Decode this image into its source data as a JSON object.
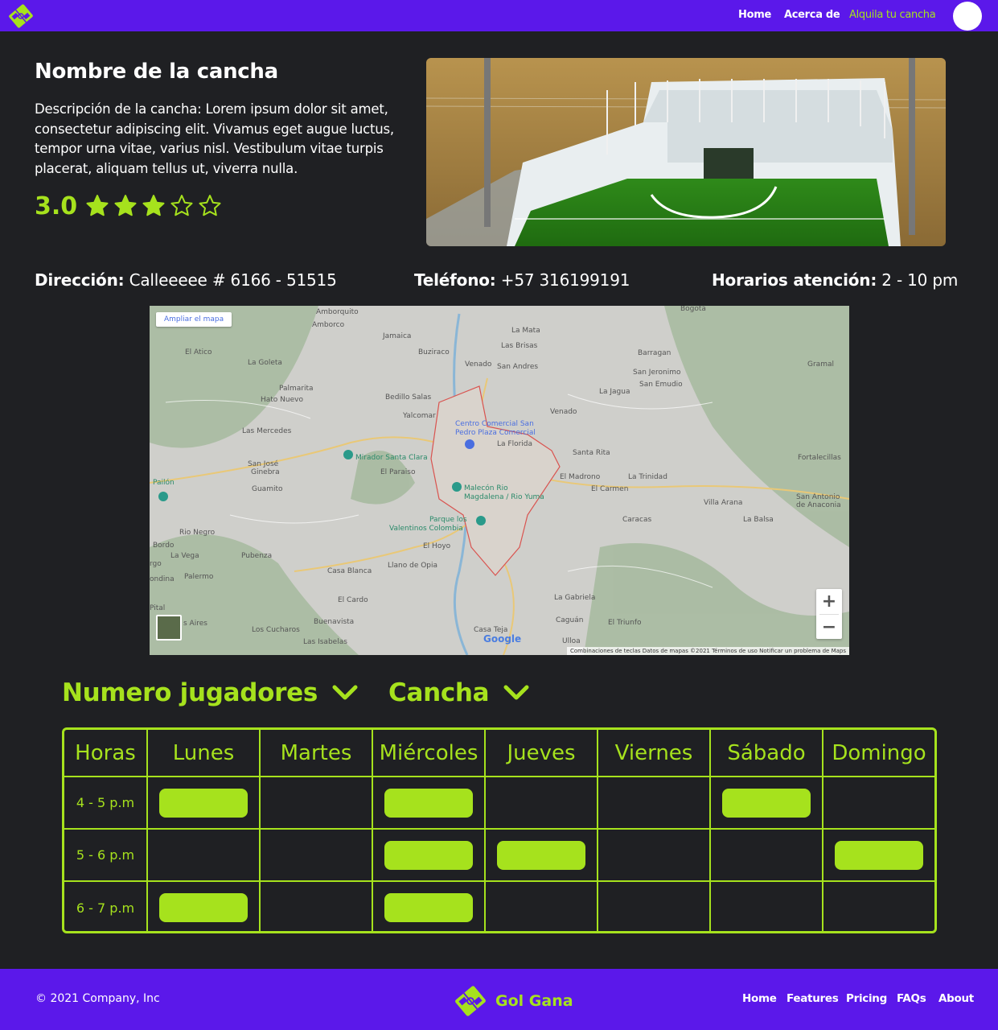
{
  "nav": {
    "home": "Home",
    "about": "Acerca de",
    "rent": "Alquila tu cancha",
    "accent_color": "#a6e21d",
    "background_color": "#5b18ea"
  },
  "court": {
    "name": "Nombre de la cancha",
    "description": "Descripción de la cancha: Lorem ipsum dolor sit amet, consectetur adipiscing elit. Vivamus eget augue luctus, tempor urna vitae, varius nisl. Vestibulum vitae turpis placerat, aliquam tellus ut, viverra nulla.",
    "rating": "3.0",
    "stars_filled": 3,
    "stars_total": 5
  },
  "info": {
    "address_label": "Dirección:",
    "address_value": "Calleeeee # 6166 - 51515",
    "phone_label": "Teléfono:",
    "phone_value": "+57 316199191",
    "hours_label": "Horarios atención:",
    "hours_value": "2 - 10 pm"
  },
  "map": {
    "expand_button": "Ampliar el mapa",
    "zoom_in": "+",
    "zoom_out": "−",
    "google": "Google",
    "footer_text": "Combinaciones de teclas   Datos de mapas ©2021   Términos de uso   Notificar un problema de Maps",
    "places": [
      "Amborquito",
      "Amborco",
      "Bogotá",
      "Jamaica",
      "La Mata",
      "Las Brisas",
      "El Atico",
      "Buziraco",
      "Venado",
      "San Andres",
      "Barragan",
      "Gramal",
      "La Goleta",
      "San Jeronimo",
      "San Emudio",
      "Palmarita",
      "Hato Nuevo",
      "La Jagua",
      "Bedillo Salas",
      "Yalcomar",
      "Venado",
      "Centro Comercial San Pedro Plaza Comercial",
      "La Florida",
      "Las Mercedes",
      "Mirador Santa Clara",
      "Santa Rita",
      "Fortalecillas",
      "San José Ginebra",
      "El Paraiso",
      "Pailón",
      "Guamito",
      "Malecón Rio Magdalena / Rio Yuma",
      "El Madrono",
      "La Trinidad",
      "El Carmen",
      "San Antonio de Anaconia",
      "Villa Arana",
      "Rio Negro",
      "Parque los Valentinos Colombia",
      "Caracas",
      "La Balsa",
      "Bordo",
      "La Vega",
      "Pubenza",
      "El Hoyo",
      "Palermo",
      "Casa Blanca",
      "Llano de Opia",
      "El Cardo",
      "La Gabriela",
      "Pital",
      "Buenavista",
      "Caguán",
      "El Triunfo",
      "Los Cucharos",
      "Las Isabelas",
      "Casa Teja",
      "Ulloa",
      "Aires",
      "ondina",
      "rgo"
    ]
  },
  "filters": {
    "players": "Numero jugadores",
    "court": "Cancha"
  },
  "schedule": {
    "headers": [
      "Horas",
      "Lunes",
      "Martes",
      "Miércoles",
      "Jueves",
      "Viernes",
      "Sábado",
      "Domingo"
    ],
    "rows": [
      {
        "hour": "4 - 5 p.m",
        "slots": [
          true,
          false,
          true,
          false,
          false,
          true,
          false
        ]
      },
      {
        "hour": "5 - 6 p.m",
        "slots": [
          false,
          false,
          true,
          true,
          false,
          false,
          true
        ]
      },
      {
        "hour": "6 - 7 p.m",
        "slots": [
          true,
          false,
          true,
          false,
          false,
          false,
          false
        ]
      }
    ]
  },
  "footer": {
    "copyright": "© 2021 Company, Inc",
    "brand": "Gol Gana",
    "links": [
      "Home",
      "Features",
      "Pricing",
      "FAQs",
      "About"
    ]
  }
}
